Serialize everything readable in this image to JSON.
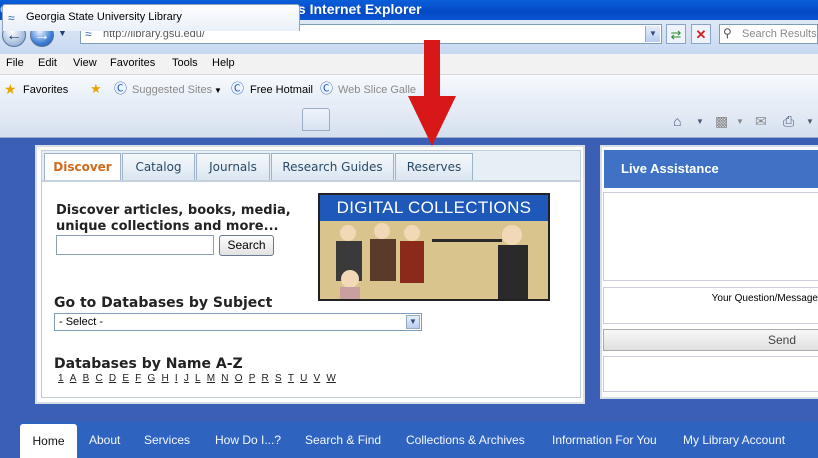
{
  "window": {
    "title": "Georgia State University Library - Windows Internet Explorer"
  },
  "address_bar": {
    "url": "http://library.gsu.edu/",
    "search_placeholder": "Search Results"
  },
  "menu": [
    "File",
    "Edit",
    "View",
    "Favorites",
    "Tools",
    "Help"
  ],
  "favorites_bar": {
    "favorites_label": "Favorites",
    "items": [
      "Suggested Sites",
      "Free Hotmail",
      "Web Slice Galle"
    ]
  },
  "browser_tab": {
    "title": "Georgia State University Library"
  },
  "search_tabs": [
    "Discover",
    "Catalog",
    "Journals",
    "Research Guides",
    "Reserves"
  ],
  "discover": {
    "prompt": "Discover articles, books, media, unique collections and more...",
    "search_button": "Search",
    "search_value": ""
  },
  "digital_collections": {
    "banner": "DIGITAL COLLECTIONS"
  },
  "databases": {
    "subject_heading": "Go to Databases by Subject",
    "subject_select": "- Select -",
    "az_heading": "Databases by Name A-Z",
    "letters": [
      "1",
      "A",
      "B",
      "C",
      "D",
      "E",
      "F",
      "G",
      "H",
      "I",
      "J",
      "L",
      "M",
      "N",
      "O",
      "P",
      "R",
      "S",
      "T",
      "U",
      "V",
      "W"
    ]
  },
  "live_assistance": {
    "title": "Live Assistance",
    "question_label": "Your Question/Message",
    "send_label": "Send"
  },
  "bottom_nav": [
    "Home",
    "About",
    "Services",
    "How Do I...?",
    "Search & Find",
    "Collections & Archives",
    "Information For You",
    "My Library Account"
  ],
  "annotation": {
    "arrow_color": "#d81818"
  },
  "colors": {
    "page_blue": "#3b5fb4",
    "nav_blue": "#2f63c0",
    "active_tab_orange": "#d06a1c"
  }
}
